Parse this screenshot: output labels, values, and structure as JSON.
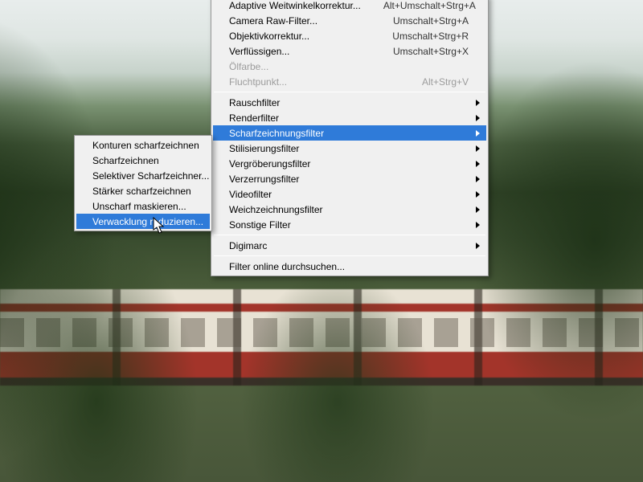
{
  "main_menu": {
    "adaptive_wide": {
      "label": "Adaptive Weitwinkelkorrektur...",
      "shortcut": "Alt+Umschalt+Strg+A"
    },
    "camera_raw": {
      "label": "Camera Raw-Filter...",
      "shortcut": "Umschalt+Strg+A"
    },
    "lens_corr": {
      "label": "Objektivkorrektur...",
      "shortcut": "Umschalt+Strg+R"
    },
    "liquify": {
      "label": "Verflüssigen...",
      "shortcut": "Umschalt+Strg+X"
    },
    "oil_paint": {
      "label": "Ölfarbe..."
    },
    "vanishing": {
      "label": "Fluchtpunkt...",
      "shortcut": "Alt+Strg+V"
    },
    "noise": {
      "label": "Rauschfilter"
    },
    "render": {
      "label": "Renderfilter"
    },
    "sharpen": {
      "label": "Scharfzeichnungsfilter"
    },
    "stylize": {
      "label": "Stilisierungsfilter"
    },
    "magnify": {
      "label": "Vergröberungsfilter"
    },
    "distort": {
      "label": "Verzerrungsfilter"
    },
    "video": {
      "label": "Videofilter"
    },
    "blur": {
      "label": "Weichzeichnungsfilter"
    },
    "other": {
      "label": "Sonstige Filter"
    },
    "digimarc": {
      "label": "Digimarc"
    },
    "browse_online": {
      "label": "Filter online durchsuchen..."
    }
  },
  "sub_menu": {
    "edges": {
      "label": "Konturen scharfzeichnen"
    },
    "sharpen": {
      "label": "Scharfzeichnen"
    },
    "selective": {
      "label": "Selektiver Scharfzeichner..."
    },
    "sharpen_more": {
      "label": "Stärker scharfzeichnen"
    },
    "unsharp": {
      "label": "Unscharf maskieren..."
    },
    "shake_reduce": {
      "label": "Verwacklung reduzieren..."
    }
  }
}
